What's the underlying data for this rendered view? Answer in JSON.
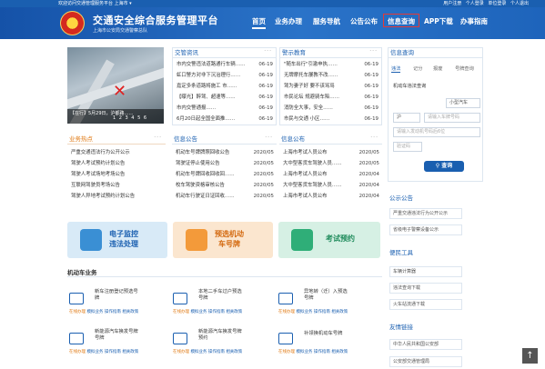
{
  "topbar": {
    "left": "欢迎访问交通管理服务平台 上海市 ▾",
    "right": "用户注册  个人登录  单位登录  个人退出"
  },
  "header": {
    "title": "交通安全综合服务管理平台",
    "subtitle": "上海市公安局交通警察总队"
  },
  "nav": {
    "home": "首页",
    "items": [
      "业务办理",
      "服务导航",
      "公告公布",
      "信息查询",
      "APP下载",
      "办事指南"
    ]
  },
  "news": {
    "caption": "【在行】5月29日，沪都路……",
    "pager": "1 2 3 4 5 6"
  },
  "traffic_news": {
    "title": "交管资讯",
    "more": "···",
    "items": [
      {
        "t": "市内交警违法道路通行车辆……",
        "d": "06-19"
      },
      {
        "t": "虹口警方对非下沉治理行……",
        "d": "06-19"
      },
      {
        "t": "嘉定多条道路将施工 市……",
        "d": "06-19"
      },
      {
        "t": "【曝光】醉驾、超速等……",
        "d": "06-19"
      },
      {
        "t": "市内交警通报……",
        "d": "06-19"
      },
      {
        "t": "6月20日起全国全面推……",
        "d": "06-19"
      }
    ]
  },
  "warning": {
    "title": "警示教育",
    "more": "···",
    "items": [
      {
        "t": "\"随车出行\"引激申执……",
        "d": "06-19"
      },
      {
        "t": "无牌摩托车屡教不改……",
        "d": "06-19"
      },
      {
        "t": "驾为妻子好 要不该骂骂",
        "d": "06-19"
      },
      {
        "t": "市民论坛 规避骑车陷……",
        "d": "06-19"
      },
      {
        "t": "消防全大事，安全……",
        "d": "06-19"
      },
      {
        "t": "市民与交通 小区……",
        "d": "06-19"
      }
    ]
  },
  "hot": {
    "title": "业务热点",
    "more": "···",
    "items": [
      "严重交通违法行为公开公示",
      "驾驶人考试预约计划公告",
      "驾驶人考试场地考场公告",
      "互联网驾驶员考场公告",
      "驾驶人异地考试预约计划公告"
    ]
  },
  "info": {
    "title": "信息公告",
    "more": "···",
    "items": [
      {
        "t": "机动车号牌牌照回收公告",
        "d": "2020/05"
      },
      {
        "t": "驾驶证停止使用公告",
        "d": "2020/05"
      },
      {
        "t": "机动车号牌回收回收回……",
        "d": "2020/05"
      },
      {
        "t": "校车驾驶资格审核公告",
        "d": "2020/05"
      },
      {
        "t": "机动车行驶证日证回收……",
        "d": "2020/05"
      }
    ]
  },
  "notice": {
    "title": "信息公布",
    "more": "···",
    "items": [
      {
        "t": "上海市考试人员公布",
        "d": "2020/05"
      },
      {
        "t": "大中型客货车驾驶人员……",
        "d": "2020/05"
      },
      {
        "t": "上海市考试人员公布",
        "d": "2020/04"
      },
      {
        "t": "大中型客货车驾驶人员……",
        "d": "2020/04"
      },
      {
        "t": "上海市考试人员公布",
        "d": "2020/04"
      }
    ]
  },
  "services": [
    {
      "label": "电子监控\n违法处理"
    },
    {
      "label": "预选机动\n车号牌"
    },
    {
      "label": "考试预约"
    }
  ],
  "business": {
    "title": "机动车业务",
    "items": [
      {
        "t": "新车注册登记预选号\n牌"
      },
      {
        "t": "本地二手车过户预选\n号牌"
      },
      {
        "t": "异地转（迁）入预选\n号牌"
      },
      {
        "t": "新能源汽车换发号牌\n号牌"
      },
      {
        "t": "新能源汽车换发号牌\n预约"
      },
      {
        "t": "补领换机动车号牌"
      }
    ],
    "links": [
      "在线办理",
      "模拟业务",
      "操作指南",
      "相关政策"
    ]
  },
  "query": {
    "title": "信息查询",
    "tabs": [
      "违法",
      "记分",
      "报废",
      "号牌查询"
    ],
    "label": "机动车违法查询",
    "plate_type": "小型汽车",
    "province": "沪",
    "plate_placeholder": "请输入车牌号码",
    "vin_placeholder": "请输入发动机号码后6位",
    "captcha_placeholder": "验证码",
    "button": "查询"
  },
  "public": {
    "title": "公示公告",
    "items": [
      "严重交通违法行为公开公示",
      "省级电子警察设备公示"
    ]
  },
  "tools": {
    "title": "便民工具",
    "items": [
      "车辆计算器",
      "违法查询下载",
      "火车站流通下载"
    ]
  },
  "links": {
    "title": "友情链接",
    "items": [
      "中华人民共和国公安部",
      "公安部交通管理局"
    ]
  }
}
